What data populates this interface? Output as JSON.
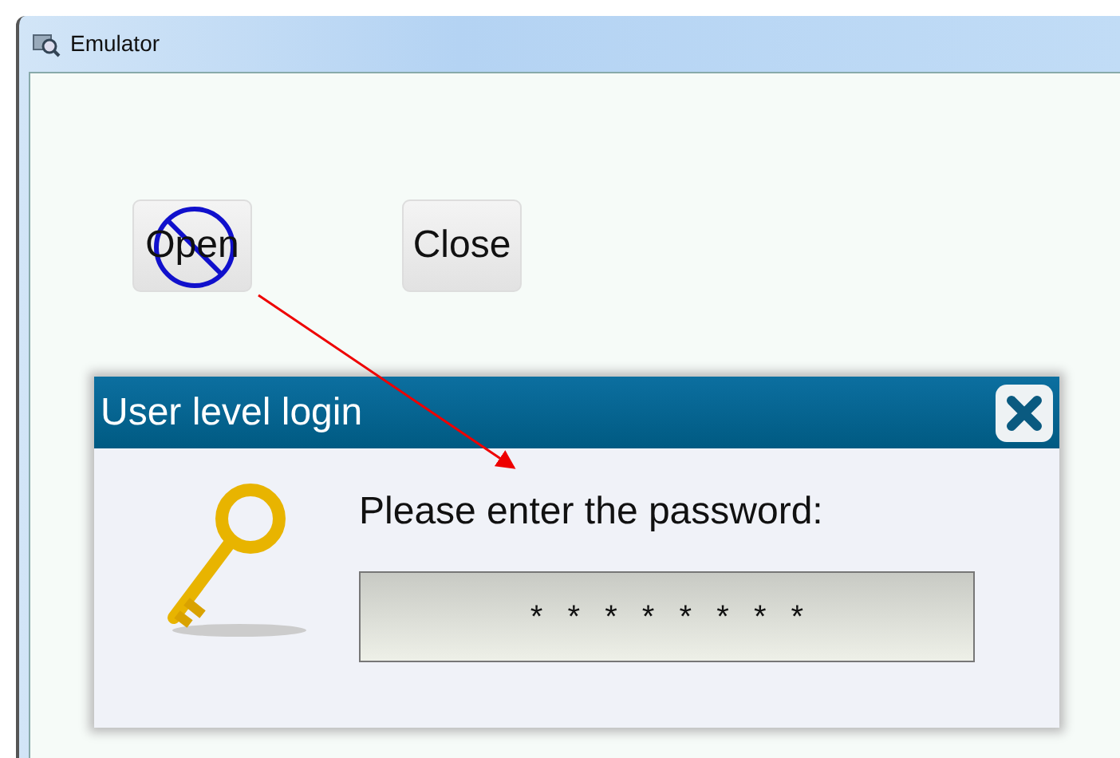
{
  "window": {
    "title": "Emulator"
  },
  "buttons": [
    {
      "label": "Open",
      "disabled": true
    },
    {
      "label": "Close",
      "disabled": false
    }
  ],
  "dialog": {
    "title": "User level login",
    "prompt": "Please enter the password:",
    "password": "* * * * * * * *"
  }
}
